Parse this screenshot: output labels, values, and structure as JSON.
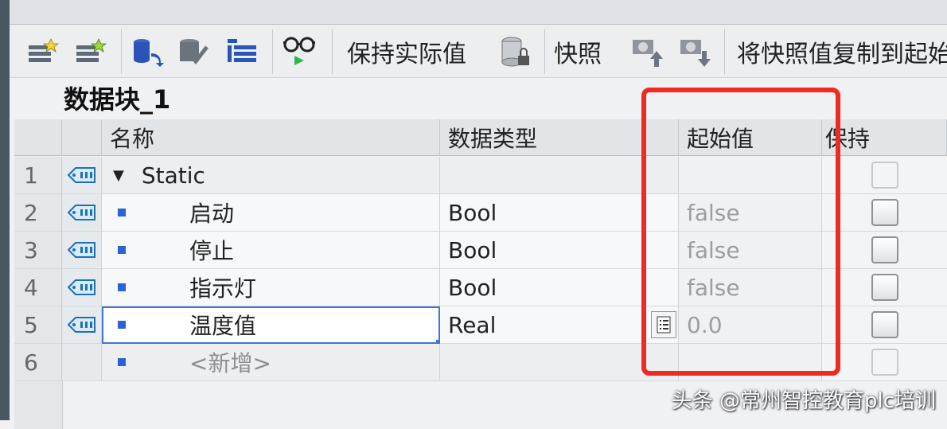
{
  "toolbar": {
    "keep_actual_label": "保持实际值",
    "snapshot_label": "快照",
    "copy_snapshot_label": "将快照值复制到起始"
  },
  "block_title": "数据块_1",
  "columns": {
    "name": "名称",
    "data_type": "数据类型",
    "start_value": "起始值",
    "retain": "保持"
  },
  "rows": [
    {
      "num": "1",
      "name": "Static",
      "type": "",
      "start": ""
    },
    {
      "num": "2",
      "name": "启动",
      "type": "Bool",
      "start": "false"
    },
    {
      "num": "3",
      "name": "停止",
      "type": "Bool",
      "start": "false"
    },
    {
      "num": "4",
      "name": "指示灯",
      "type": "Bool",
      "start": "false"
    },
    {
      "num": "5",
      "name": "温度值",
      "type": "Real",
      "start": "0.0"
    },
    {
      "num": "6",
      "name": "<新增>",
      "type": "",
      "start": ""
    }
  ],
  "watermark": "头条 @常州智控教育plc培训",
  "colors": {
    "highlight": "#ef2a23",
    "bullet": "#2a63d8",
    "selection": "#3b77d6"
  }
}
